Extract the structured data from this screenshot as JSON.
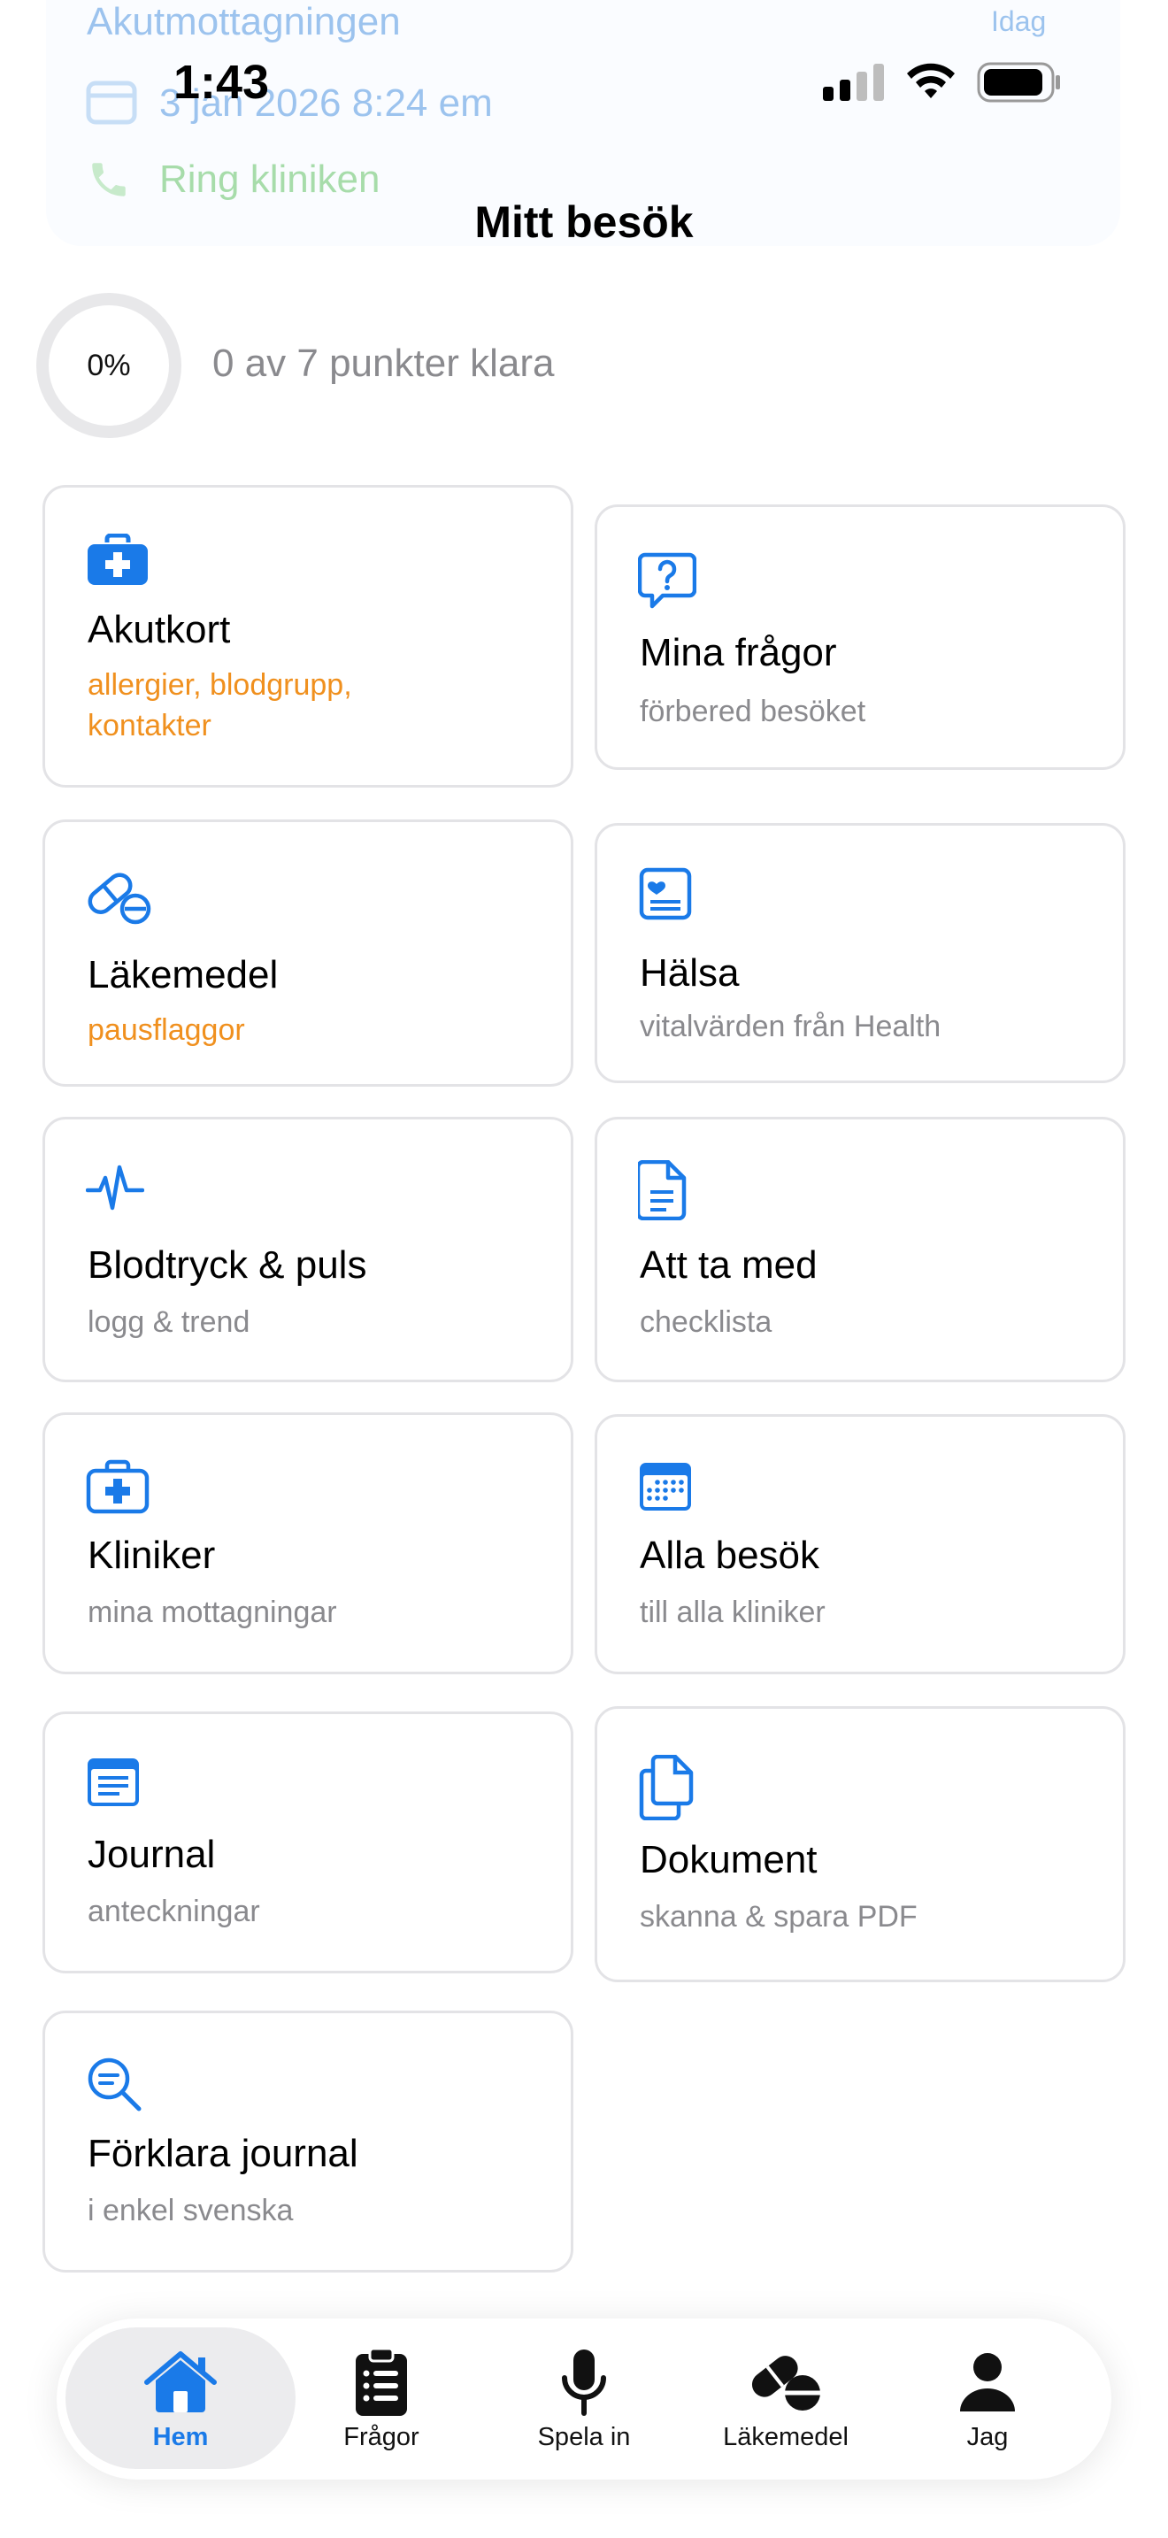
{
  "background_card": {
    "line1": "Akutmottagningen",
    "line2": "3 jan 2026 8:24 em",
    "line3": "Ring kliniken",
    "badge": "Idag"
  },
  "status_bar": {
    "time": "1:43"
  },
  "header": {
    "title": "Mitt besök"
  },
  "progress": {
    "percent_label": "0%",
    "fraction": 0,
    "summary": "0 av 7 punkter klara"
  },
  "colors": {
    "accent": "#1a7ae8",
    "warning": "#f0901e",
    "subtitle": "#8a8a8e",
    "border": "#e3e3e6"
  },
  "tiles": [
    {
      "title": "Akutkort",
      "subtitle": "allergier, blodgrupp, kontakter",
      "subtitle_color": "orange",
      "icon": "medical-kit-icon"
    },
    {
      "title": "Mina frågor",
      "subtitle": "förbered besöket",
      "subtitle_color": "gray",
      "icon": "question-bubble-icon"
    },
    {
      "title": "Läkemedel",
      "subtitle": "pausflaggor",
      "subtitle_color": "orange",
      "icon": "pills-icon"
    },
    {
      "title": "Hälsa",
      "subtitle": "vitalvärden från Health",
      "subtitle_color": "gray",
      "icon": "health-record-icon"
    },
    {
      "title": "Blodtryck & puls",
      "subtitle": "logg & trend",
      "subtitle_color": "gray",
      "icon": "heartbeat-icon"
    },
    {
      "title": "Att ta med",
      "subtitle": "checklista",
      "subtitle_color": "gray",
      "icon": "document-icon"
    },
    {
      "title": "Kliniker",
      "subtitle": "mina mottagningar",
      "subtitle_color": "gray",
      "icon": "clinic-kit-icon"
    },
    {
      "title": "Alla besök",
      "subtitle": "till alla kliniker",
      "subtitle_color": "gray",
      "icon": "calendar-icon"
    },
    {
      "title": "Journal",
      "subtitle": "anteckningar",
      "subtitle_color": "gray",
      "icon": "journal-icon"
    },
    {
      "title": "Dokument",
      "subtitle": "skanna & spara PDF",
      "subtitle_color": "gray",
      "icon": "documents-icon"
    },
    {
      "title": "Förklara journal",
      "subtitle": "i enkel svenska",
      "subtitle_color": "gray",
      "icon": "search-text-icon"
    }
  ],
  "tabbar": {
    "tabs": [
      {
        "label": "Hem",
        "icon": "house-icon",
        "active": true
      },
      {
        "label": "Frågor",
        "icon": "clipboard-icon",
        "active": false
      },
      {
        "label": "Spela in",
        "icon": "microphone-icon",
        "active": false
      },
      {
        "label": "Läkemedel",
        "icon": "pills-icon",
        "active": false
      },
      {
        "label": "Jag",
        "icon": "person-icon",
        "active": false
      }
    ]
  }
}
